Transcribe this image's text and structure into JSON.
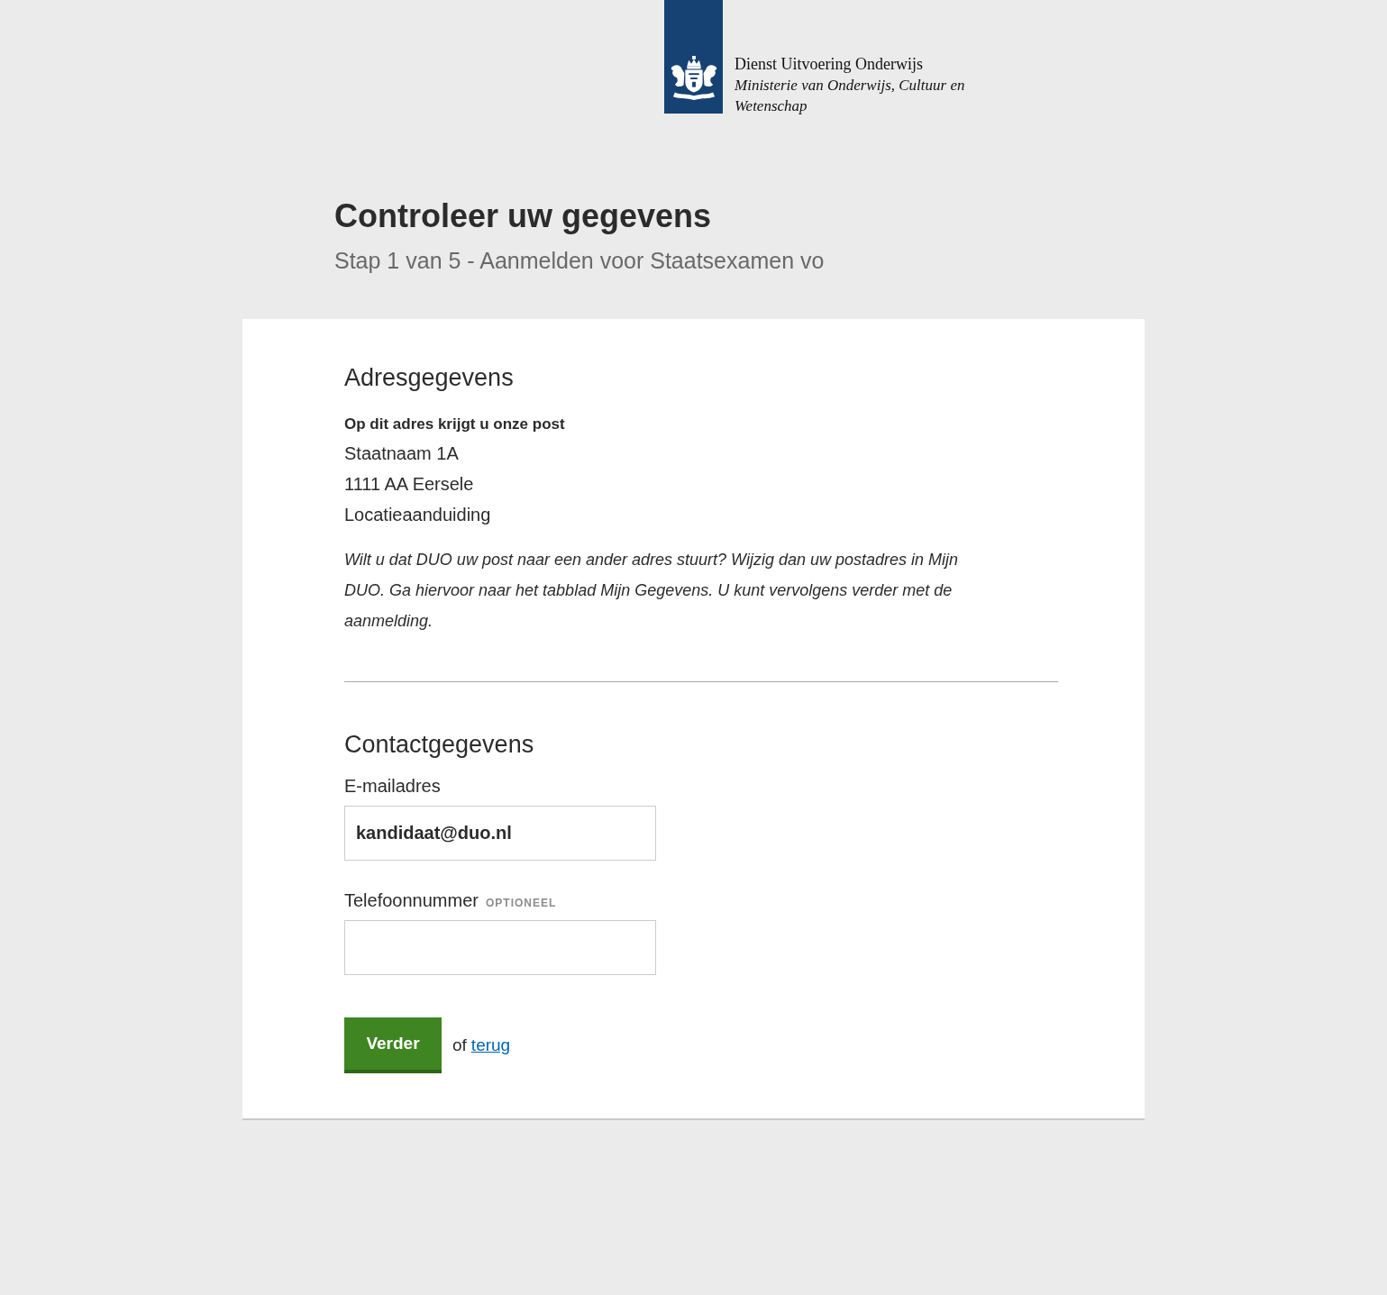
{
  "header": {
    "organisation": "Dienst Uitvoering Onderwijs",
    "ministry": "Ministerie van Onderwijs, Cultuur en Wetenschap"
  },
  "page": {
    "title": "Controleer uw gegevens",
    "subtitle": "Stap 1 van 5 - Aanmelden voor Staatsexamen vo"
  },
  "address_section": {
    "heading": "Adresgegevens",
    "label": "Op dit adres krijgt u onze post",
    "lines": [
      "Staatnaam 1A",
      "1111 AA Eersele",
      "Locatieaanduiding"
    ],
    "note": "Wilt u dat DUO uw post naar een ander adres stuurt? Wijzig dan uw postadres in Mijn DUO. Ga hiervoor naar het tabblad Mijn Gegevens. U kunt vervolgens verder met de aanmelding."
  },
  "contact_section": {
    "heading": "Contactgegevens",
    "fields": [
      {
        "label": "E-mailadres",
        "value": "kandidaat@duo.nl"
      },
      {
        "label": "Telefoonnummer",
        "tag": "OPTIONEEL"
      }
    ]
  },
  "actions": {
    "primary": "Verder",
    "separator": "of",
    "link": "terug"
  }
}
